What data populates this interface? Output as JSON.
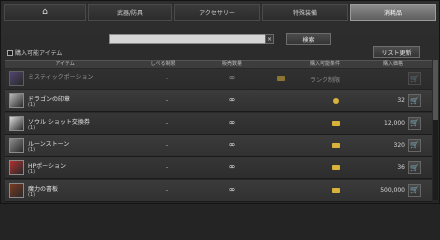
{
  "tabs": [
    {
      "label": "",
      "icon": "home-icon"
    },
    {
      "label": "武器/防具"
    },
    {
      "label": "アクセサリー"
    },
    {
      "label": "特殊装備"
    },
    {
      "label": "消耗品",
      "active": true
    }
  ],
  "search": {
    "value": "",
    "clear_label": "×",
    "button_label": "検索"
  },
  "filter": {
    "label": "購入可能アイテム",
    "checked": false
  },
  "refresh_label": "リスト更新",
  "columns": [
    "アイテム",
    "しべる制限",
    "販売数量",
    "購入可能条件",
    "購入価格"
  ],
  "rows": [
    {
      "name": "ミスティックポーション",
      "qty": "",
      "limit": "-",
      "stock": "∞",
      "condition": "ランク制限",
      "price": "",
      "dim": true,
      "icon_color": "#6f5ca8"
    },
    {
      "name": "ドラゴンの印章",
      "qty": "(1)",
      "limit": "-",
      "stock": "∞",
      "condition": "",
      "price": "32",
      "icon_color": "#b9b9b9"
    },
    {
      "name": "ソウル ショット交換券",
      "qty": "(1)",
      "limit": "-",
      "stock": "∞",
      "condition": "",
      "price": "12,000",
      "icon_color": "#dcdcdc"
    },
    {
      "name": "ルーンストーン",
      "qty": "(1)",
      "limit": "-",
      "stock": "∞",
      "condition": "",
      "price": "320",
      "icon_color": "#8c8c8c"
    },
    {
      "name": "HPポーション",
      "qty": "(1)",
      "limit": "-",
      "stock": "∞",
      "condition": "",
      "price": "36",
      "icon_color": "#b03030"
    },
    {
      "name": "魔力の書板",
      "qty": "(1)",
      "limit": "-",
      "stock": "∞",
      "condition": "",
      "price": "500,000",
      "icon_color": "#7a3a20"
    }
  ]
}
